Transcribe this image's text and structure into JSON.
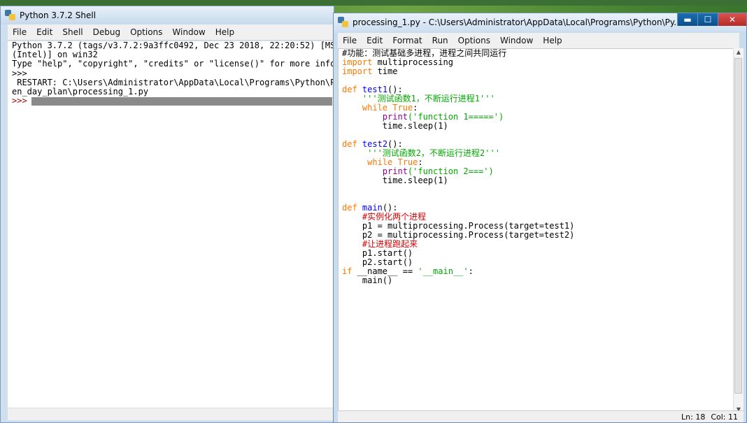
{
  "shell": {
    "title": "Python 3.7.2 Shell",
    "menu": [
      "File",
      "Edit",
      "Shell",
      "Debug",
      "Options",
      "Window",
      "Help"
    ],
    "lines": [
      "Python 3.7.2 (tags/v3.7.2:9a3ffc0492, Dec 23 2018, 22:20:52) [MSC",
      "(Intel)] on win32",
      "Type \"help\", \"copyright\", \"credits\" or \"license()\" for more infor",
      ">>>",
      " RESTART: C:\\Users\\Administrator\\AppData\\Local\\Programs\\Python\\Py",
      "en_day_plan\\processing_1.py",
      ">>>"
    ]
  },
  "editor": {
    "title": "processing_1.py - C:\\Users\\Administrator\\AppData\\Local\\Programs\\Python\\Py...",
    "menu": [
      "File",
      "Edit",
      "Format",
      "Run",
      "Options",
      "Window",
      "Help"
    ],
    "code": {
      "c1": "#功能：测试基础多进程，进程之间共同运行",
      "imp": "import",
      "m1": " multiprocessing",
      "m2": " time",
      "def": "def",
      "test1": "test1",
      "test2": "test2",
      "main": "main",
      "parens": "():",
      "doc1": "'''测试函数1，不断运行进程1'''",
      "doc2": "'''测试函数2，不断运行进程2'''",
      "while": "while",
      "true": "True",
      "colon": ":",
      "print": "print",
      "s1": "('function 1=====')",
      "s2": "('function 2===')",
      "sleep": "time.sleep(1)",
      "c2": "#实例化两个进程",
      "p1": "p1 = multiprocessing.Process(target=test1)",
      "p2": "p2 = multiprocessing.Process(target=test2)",
      "c3": "#让进程跑起来",
      "p1s": "p1.start()",
      "p2s": "p2.start()",
      "if": "if",
      "name": " __name__ == ",
      "mainstr": "'__main__'",
      "callmain": "main()"
    },
    "status": {
      "ln": "Ln: 18",
      "col": "Col: 11"
    },
    "buttons": {
      "min": "▬",
      "max": "☐",
      "close": "✕"
    }
  }
}
